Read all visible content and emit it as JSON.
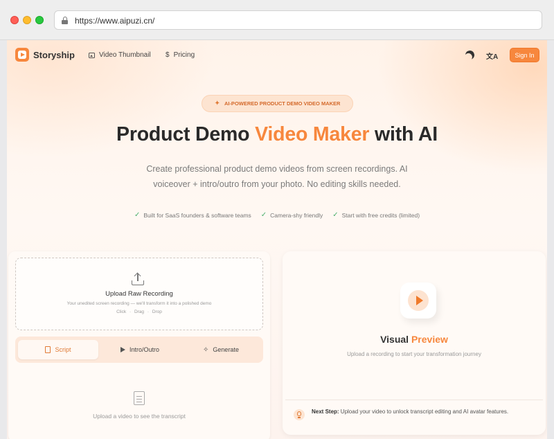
{
  "browser": {
    "url": "https://www.aipuzi.cn/"
  },
  "nav": {
    "brand": "Storyship",
    "links": [
      {
        "label": "Video Thumbnail",
        "icon": "image-icon"
      },
      {
        "label": "Pricing",
        "icon": "dollar-icon"
      }
    ],
    "sign_in": "Sign In"
  },
  "hero": {
    "badge": "AI-POWERED PRODUCT DEMO VIDEO MAKER",
    "title_before": "Product Demo ",
    "title_accent": "Video Maker",
    "title_after": " with AI",
    "subtitle": "Create professional product demo videos from screen recordings. AI voiceover + intro/outro from your photo. No editing skills needed.",
    "features": [
      "Built for SaaS founders & software teams",
      "Camera-shy friendly",
      "Start with free credits (limited)"
    ]
  },
  "upload": {
    "title": "Upload Raw Recording",
    "description": "Your unedited screen recording — we'll transform it into a polished demo",
    "actions": "Click · Drag · Drop"
  },
  "tabs": [
    {
      "label": "Script",
      "active": true
    },
    {
      "label": "Intro/Outro",
      "active": false
    },
    {
      "label": "Generate",
      "active": false
    }
  ],
  "transcript": {
    "empty_text": "Upload a video to see the transcript"
  },
  "preview": {
    "title_before": "Visual ",
    "title_accent": "Preview",
    "description": "Upload a recording to start your transformation journey",
    "next_step_label": "Next Step:",
    "next_step_text": " Upload your video to unlock transcript editing and AI avatar features."
  },
  "colors": {
    "accent": "#f7873d",
    "check": "#4caf6d"
  }
}
